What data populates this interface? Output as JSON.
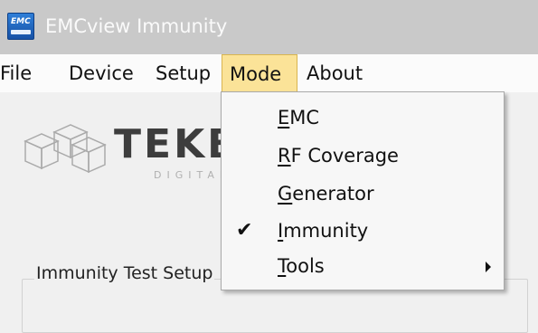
{
  "window": {
    "title": "EMCview Immunity",
    "icon": "emc-app-icon",
    "icon_text": "EMC"
  },
  "menubar": {
    "items": [
      {
        "label": "File"
      },
      {
        "label": "Device"
      },
      {
        "label": "Setup"
      },
      {
        "label": "Mode",
        "active": true
      },
      {
        "label": "About"
      }
    ]
  },
  "logo": {
    "text": "TEKB",
    "subtext": "DIGITAL SI"
  },
  "mode_menu": {
    "items": [
      {
        "label_first": "E",
        "label_rest": "MC",
        "checked": false
      },
      {
        "label_first": "R",
        "label_rest": "F Coverage",
        "checked": false
      },
      {
        "label_first": "G",
        "label_rest": "enerator",
        "checked": false
      },
      {
        "label_first": "I",
        "label_rest": "mmunity",
        "checked": true
      },
      {
        "label_first": "T",
        "label_rest": "ools",
        "checked": false,
        "submenu": true
      }
    ],
    "check_glyph": "✔"
  },
  "setup_group": {
    "label": "Immunity Test Setup"
  },
  "colors": {
    "titlebar": "#c9c9c9",
    "menu_highlight": "#fbe398",
    "menubar": "#fbfbfb"
  }
}
